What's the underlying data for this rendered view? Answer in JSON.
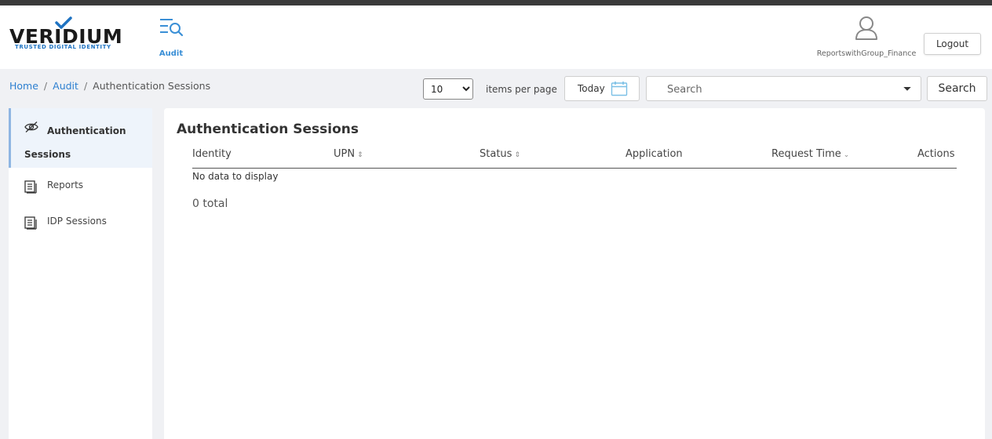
{
  "brand": {
    "name": "VERIDIUM",
    "tagline": "TRUSTED DIGITAL IDENTITY",
    "accent": "#1f73c2"
  },
  "nav": {
    "audit_label": "Audit"
  },
  "user": {
    "name": "ReportswithGroup_Finance",
    "logout_label": "Logout"
  },
  "breadcrumb": {
    "home": "Home",
    "audit": "Audit",
    "current": "Authentication Sessions"
  },
  "toolbar": {
    "page_size": "10",
    "items_per_page": "items per page",
    "today_label": "Today",
    "search_placeholder": "Search",
    "search_button": "Search"
  },
  "sidebar": {
    "items": [
      {
        "label": "Authentication Sessions",
        "icon": "eye-slash-icon",
        "active": true
      },
      {
        "label": "Reports",
        "icon": "document-list-icon",
        "active": false
      },
      {
        "label": "IDP Sessions",
        "icon": "document-list-icon",
        "active": false
      }
    ]
  },
  "main": {
    "title": "Authentication Sessions",
    "columns": [
      "Identity",
      "UPN",
      "Status",
      "Application",
      "Request Time",
      "Actions"
    ],
    "empty_text": "No data to display",
    "total_text": "0 total"
  }
}
